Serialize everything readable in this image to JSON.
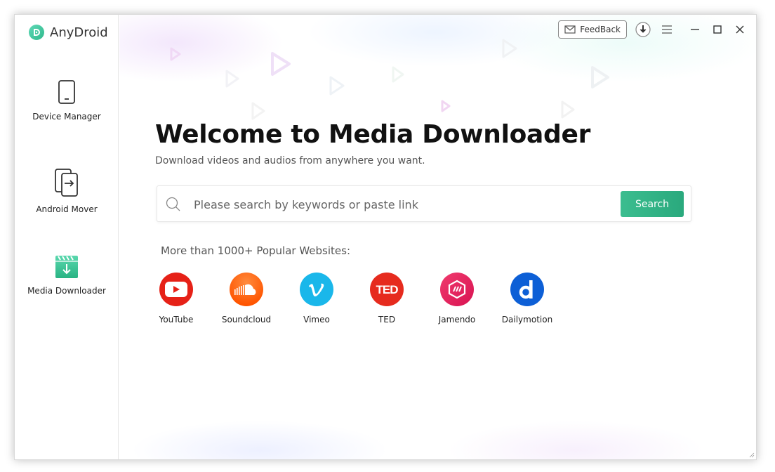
{
  "app": {
    "name": "AnyDroid"
  },
  "sidebar": {
    "items": [
      {
        "label": "Device Manager",
        "icon": "phone-icon"
      },
      {
        "label": "Android Mover",
        "icon": "transfer-icon"
      },
      {
        "label": "Media Downloader",
        "icon": "download-clapper-icon",
        "active": true
      }
    ]
  },
  "titlebar": {
    "feedback_label": "FeedBack"
  },
  "main": {
    "title": "Welcome to Media Downloader",
    "subtitle": "Download videos and audios from anywhere you want.",
    "search": {
      "placeholder": "Please search by keywords or paste link",
      "value": "",
      "button_label": "Search"
    },
    "popular_label": "More than 1000+ Popular Websites:",
    "sites": [
      {
        "label": "YouTube",
        "color": "#e62117",
        "icon": "youtube-icon"
      },
      {
        "label": "Soundcloud",
        "color": "#ff5500",
        "icon": "soundcloud-icon"
      },
      {
        "label": "Vimeo",
        "color": "#1ab7ea",
        "icon": "vimeo-icon"
      },
      {
        "label": "TED",
        "color": "#e62b1e",
        "icon": "ted-icon"
      },
      {
        "label": "Jamendo",
        "color": "#e8175d",
        "icon": "jamendo-icon"
      },
      {
        "label": "Dailymotion",
        "color": "#0d5fd6",
        "icon": "dailymotion-icon"
      }
    ]
  },
  "colors": {
    "accent": "#2fb488",
    "brand": "#3cc99a"
  }
}
